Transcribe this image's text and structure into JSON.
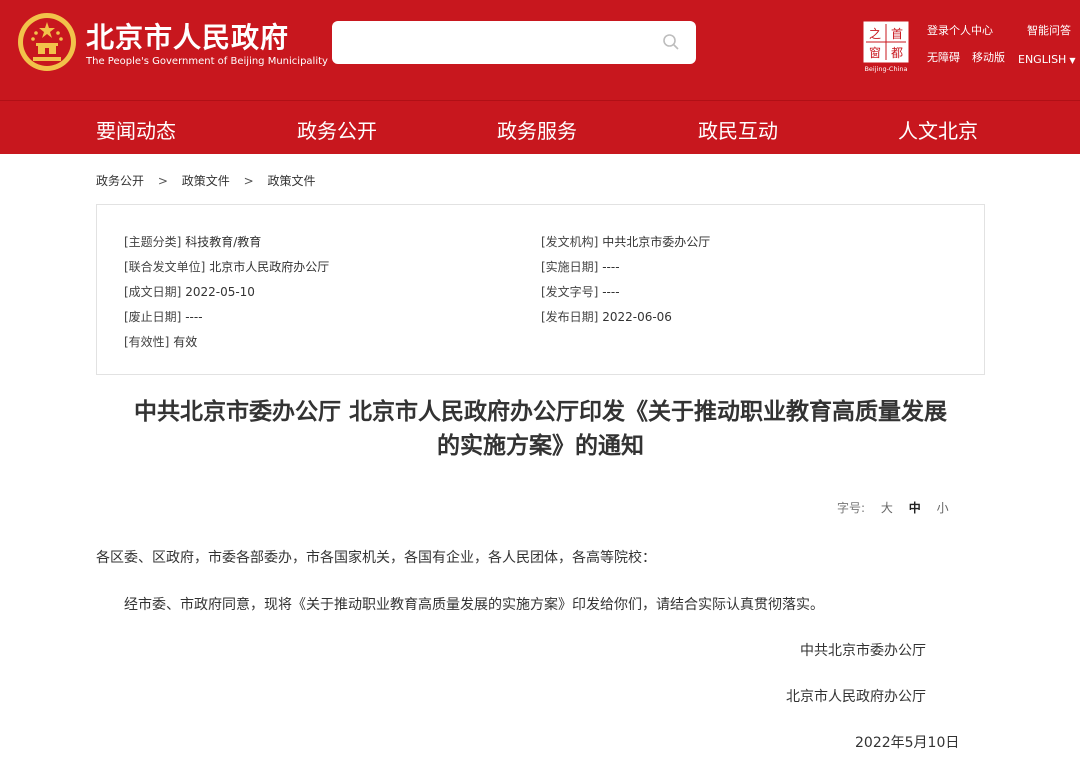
{
  "header": {
    "site_title": "北京市人民政府",
    "site_subtitle": "The People's Government of Beijing Municipality",
    "search": {
      "placeholder": ""
    },
    "capital_logo_caption": "Beijing-China",
    "top_links": [
      "登录个人中心",
      "智能问答",
      "无障碍",
      "移动版"
    ],
    "language": "ENGLISH",
    "colors": {
      "brand_red": "#c8171e",
      "emblem_gold": "#f2c24a"
    }
  },
  "nav": {
    "items": [
      "要闻动态",
      "政务公开",
      "政务服务",
      "政民互动",
      "人文北京"
    ]
  },
  "breadcrumb": [
    "政务公开",
    "政策文件",
    "政策文件"
  ],
  "breadcrumb_separator": ">",
  "meta": {
    "left": [
      {
        "label": "[主题分类]",
        "value": "科技教育/教育"
      },
      {
        "label": "[联合发文单位]",
        "value": "北京市人民政府办公厅"
      },
      {
        "label": "[成文日期]",
        "value": "2022-05-10"
      },
      {
        "label": "[废止日期]",
        "value": "----"
      },
      {
        "label": "[有效性]",
        "value": "有效"
      }
    ],
    "right": [
      {
        "label": "[发文机构]",
        "value": "中共北京市委办公厅"
      },
      {
        "label": "[实施日期]",
        "value": "----"
      },
      {
        "label": "[发文字号]",
        "value": "----"
      },
      {
        "label": "[发布日期]",
        "value": "2022-06-06"
      }
    ]
  },
  "document": {
    "title_line1": "中共北京市委办公厅 北京市人民政府办公厅印发《关于推动职业教育高质量发展",
    "title_line2": "的实施方案》的通知",
    "font_size_label": "字号:",
    "font_size_options": [
      "大",
      "中",
      "小"
    ],
    "font_size_selected": "中",
    "salutation": "各区委、区政府，市委各部委办，市各国家机关，各国有企业，各人民团体，各高等院校：",
    "paragraph": "经市委、市政府同意，现将《关于推动职业教育高质量发展的实施方案》印发给你们，请结合实际认真贯彻落实。",
    "signature_1": "中共北京市委办公厅",
    "signature_2": "北京市人民政府办公厅",
    "date": "2022年5月10日"
  }
}
